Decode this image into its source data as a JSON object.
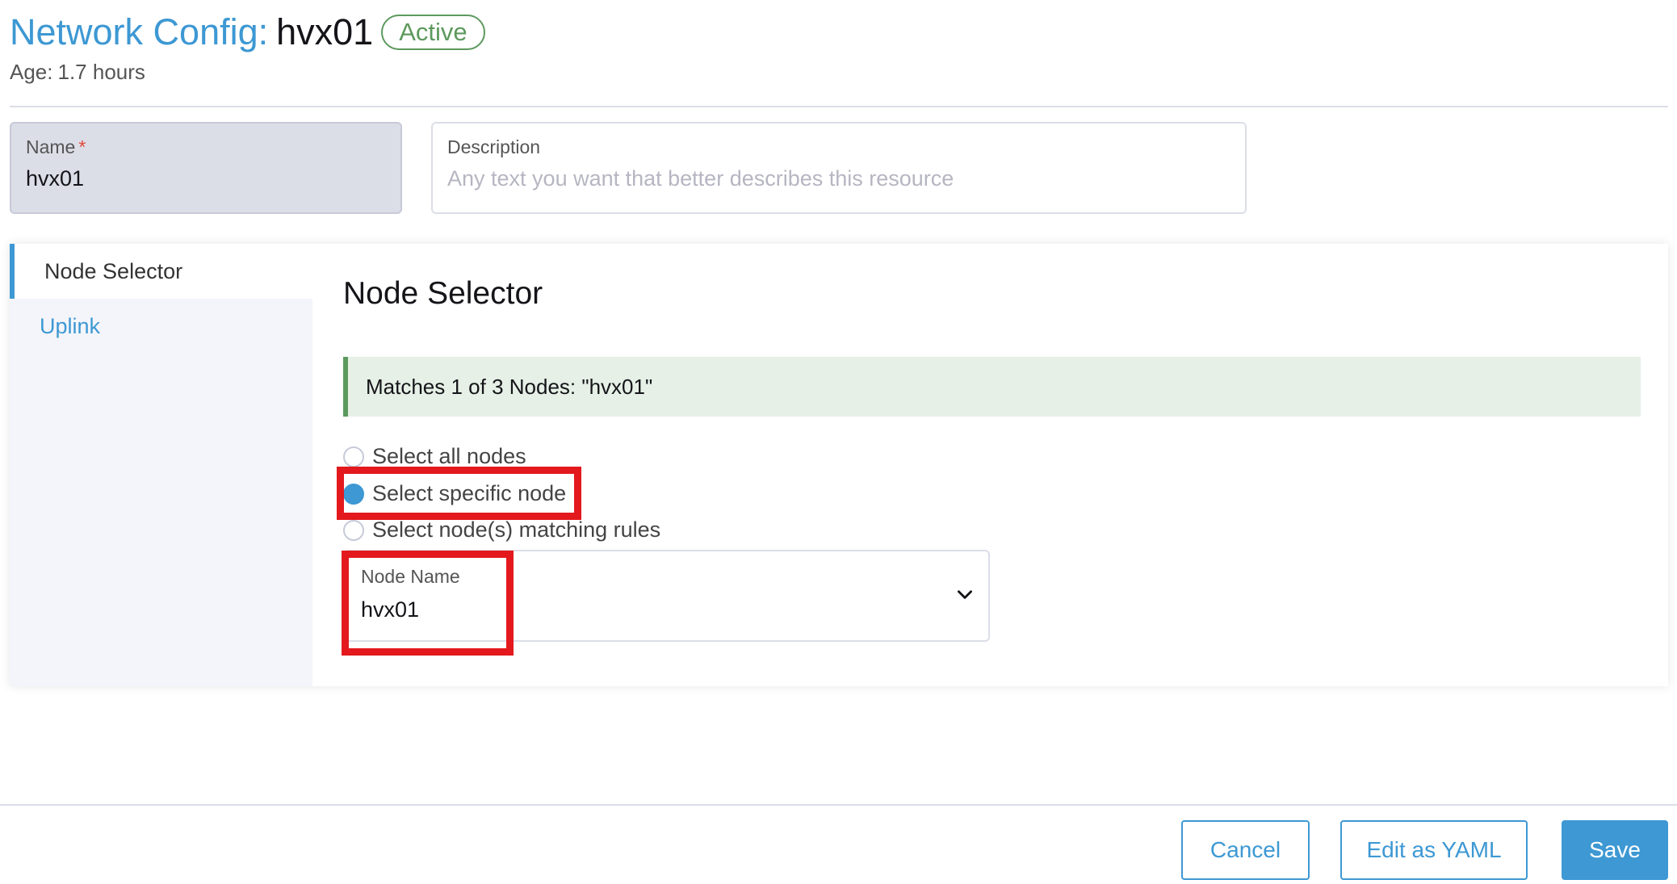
{
  "header": {
    "title_prefix": "Network Config:",
    "resource_name": "hvx01",
    "status": "Active",
    "age_label": "Age:",
    "age_value": "1.7 hours"
  },
  "form": {
    "name_label": "Name",
    "required_mark": "*",
    "name_value": "hvx01",
    "description_label": "Description",
    "description_placeholder": "Any text you want that better describes this resource"
  },
  "tabs": [
    {
      "label": "Node Selector",
      "active": true
    },
    {
      "label": "Uplink",
      "active": false
    }
  ],
  "node_selector": {
    "title": "Node Selector",
    "match_banner": "Matches 1 of 3 Nodes: \"hvx01\"",
    "options": [
      {
        "label": "Select all nodes",
        "checked": false
      },
      {
        "label": "Select specific node",
        "checked": true
      },
      {
        "label": "Select node(s) matching rules",
        "checked": false
      }
    ],
    "node_name_label": "Node Name",
    "node_name_value": "hvx01"
  },
  "footer": {
    "cancel_label": "Cancel",
    "edit_yaml_label": "Edit as YAML",
    "save_label": "Save"
  },
  "colors": {
    "accent": "#3d98d3",
    "success": "#5d995d",
    "highlight": "#e3191d"
  }
}
